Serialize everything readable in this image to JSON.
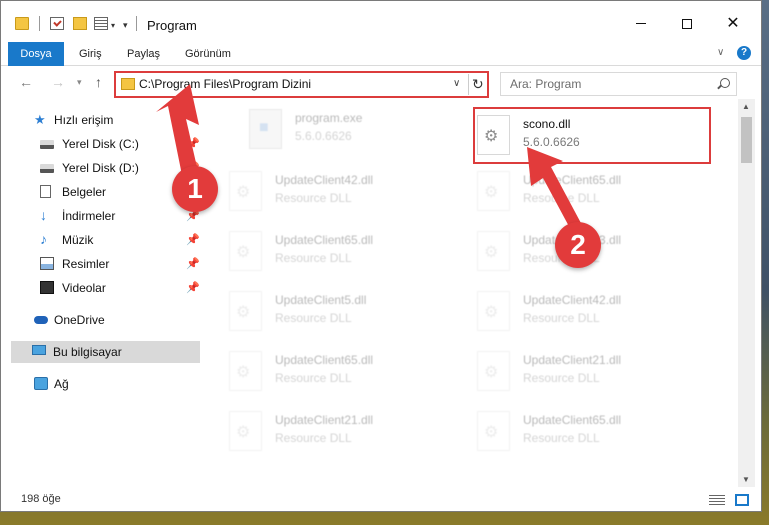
{
  "window": {
    "title": "Program"
  },
  "ribbon": {
    "tabs": [
      "Dosya",
      "Giriş",
      "Paylaş",
      "Görünüm"
    ]
  },
  "nav": {
    "address": "C:\\Program Files\\Program Dizini",
    "search_placeholder": "Ara: Program"
  },
  "sidebar": {
    "items": [
      {
        "label": "Hızlı erişim",
        "icon": "star-icon"
      },
      {
        "label": "Yerel Disk (C:)",
        "icon": "drive-icon",
        "pinned": true
      },
      {
        "label": "Yerel Disk (D:)",
        "icon": "drive-icon",
        "pinned": true
      },
      {
        "label": "Belgeler",
        "icon": "document-icon",
        "pinned": true
      },
      {
        "label": "İndirmeler",
        "icon": "download-icon",
        "pinned": true
      },
      {
        "label": "Müzik",
        "icon": "music-icon",
        "pinned": true
      },
      {
        "label": "Resimler",
        "icon": "pictures-icon",
        "pinned": true
      },
      {
        "label": "Videolar",
        "icon": "video-icon",
        "pinned": true
      },
      {
        "label": "OneDrive",
        "icon": "cloud-icon"
      },
      {
        "label": "Bu bilgisayar",
        "icon": "computer-icon",
        "selected": true
      },
      {
        "label": "Ağ",
        "icon": "network-icon"
      }
    ]
  },
  "files": [
    {
      "name": "program.exe",
      "desc": "5.6.0.6626"
    },
    {
      "name": "scono.dll",
      "desc": "5.6.0.6626"
    },
    {
      "name": "UpdateClient42.dll",
      "desc": "Resource DLL"
    },
    {
      "name": "UpdateClient65.dll",
      "desc": "Resource DLL"
    },
    {
      "name": "UpdateClient65.dll",
      "desc": "Resource DLL"
    },
    {
      "name": "UpdateClient63.dll",
      "desc": "Resource DLL"
    },
    {
      "name": "UpdateClient5.dll",
      "desc": "Resource DLL"
    },
    {
      "name": "UpdateClient42.dll",
      "desc": "Resource DLL"
    },
    {
      "name": "UpdateClient65.dll",
      "desc": "Resource DLL"
    },
    {
      "name": "UpdateClient21.dll",
      "desc": "Resource DLL"
    },
    {
      "name": "UpdateClient21.dll",
      "desc": "Resource DLL"
    },
    {
      "name": "UpdateClient65.dll",
      "desc": "Resource DLL"
    }
  ],
  "status": {
    "item_count": "198 öğe"
  },
  "annotations": {
    "step1": "1",
    "step2": "2"
  },
  "colors": {
    "accent": "#1979ca",
    "annotation": "#dc3c3c"
  }
}
